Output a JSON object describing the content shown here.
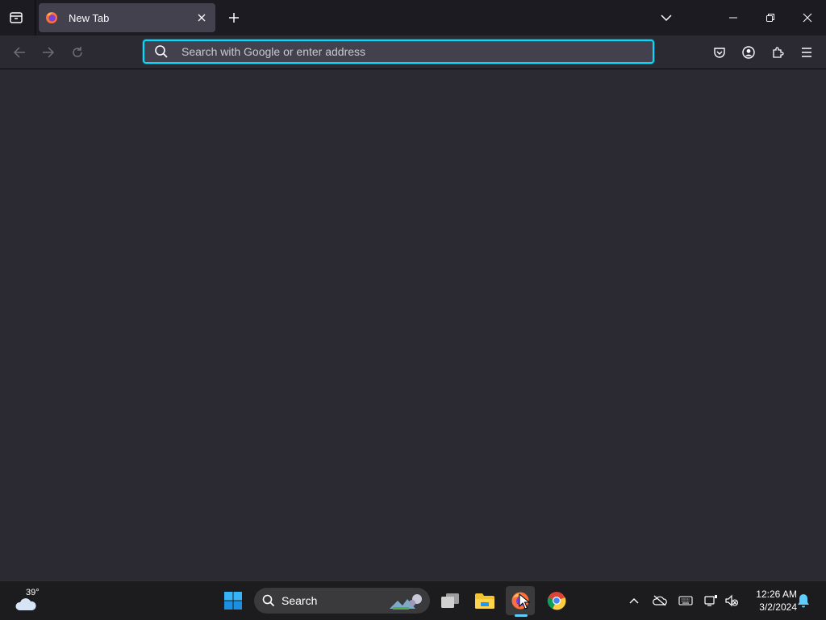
{
  "browser": {
    "tab": {
      "title": "New Tab"
    },
    "urlbar": {
      "placeholder": "Search with Google or enter address"
    }
  },
  "taskbar": {
    "weather": {
      "temp": "39°"
    },
    "search": {
      "label": "Search"
    },
    "clock": {
      "time": "12:26 AM",
      "date": "3/2/2024"
    }
  },
  "colors": {
    "tabbar_bg": "#1c1b22",
    "toolbar_bg": "#2b2a33",
    "content_bg": "#2b2a33",
    "urlbar_focus": "#00ddff",
    "taskbar_bg": "#1c1c1e",
    "active_indicator": "#60cdff"
  }
}
